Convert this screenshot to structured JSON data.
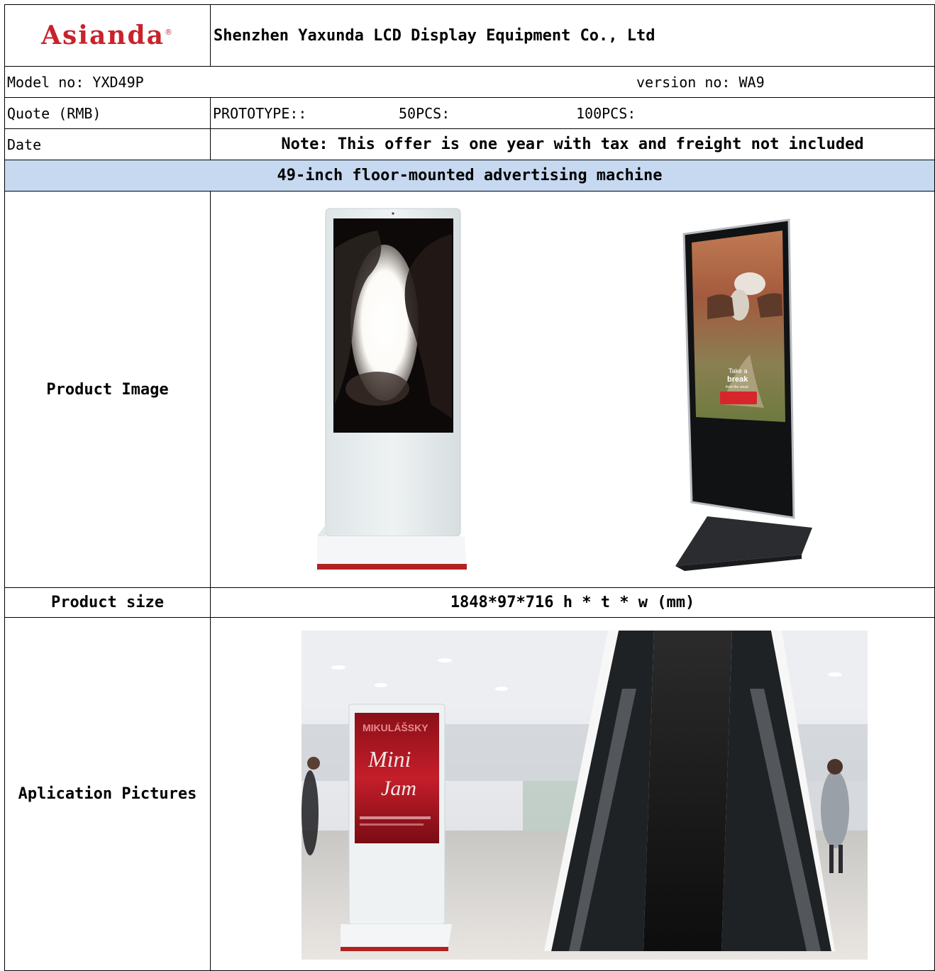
{
  "header": {
    "logo": "Asianda",
    "logo_mark": "®",
    "company": "Shenzhen Yaxunda LCD Display Equipment Co., Ltd"
  },
  "model": {
    "label": "Model no: YXD49P",
    "version": "version no: WA9"
  },
  "quote": {
    "label": "Quote (RMB)",
    "prototype": "PROTOTYPE::",
    "pcs50": "50PCS:",
    "pcs100": "100PCS:"
  },
  "date": {
    "label": "Date",
    "note": "Note: This offer is one year with tax and freight not included"
  },
  "product_title": "49-inch floor-mounted advertising machine",
  "product_image": {
    "label": "Product Image",
    "image1_ad_text": [],
    "image2_ad_text": [
      "Take a",
      "break",
      "from the usual"
    ]
  },
  "product_size": {
    "label": "Product size",
    "value": "1848*97*716 h * t * w (mm)"
  },
  "application": {
    "label": "Aplication Pictures",
    "poster_text": [
      "MIKULÁŠSKY",
      "Mini",
      "Jam"
    ]
  },
  "colors": {
    "title_band": "#c6d9f0",
    "logo_red": "#c8232c",
    "kiosk_white": "#e8eef0",
    "base_red": "#b22222"
  },
  "icons": {
    "kiosk_white": "white-kiosk-icon",
    "kiosk_black": "black-kiosk-icon"
  }
}
